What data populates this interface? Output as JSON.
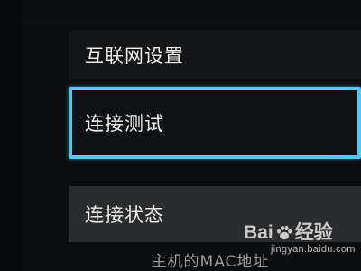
{
  "menu": {
    "items": [
      {
        "label": "互联网设置",
        "state": "normal"
      },
      {
        "label": "连接测试",
        "state": "focused"
      },
      {
        "label": "连接状态",
        "state": "normal"
      },
      {
        "label": "主机的MAC地址",
        "state": "partial"
      }
    ]
  },
  "watermark": {
    "brand_left": "Bai",
    "brand_right": "经验",
    "url": "jingyan.baidu.com",
    "icon": "baidu-paw-icon"
  },
  "colors": {
    "focus_border": "#56c8ef",
    "background": "#0c0d0e",
    "selected_row": "#2a2c2d"
  }
}
